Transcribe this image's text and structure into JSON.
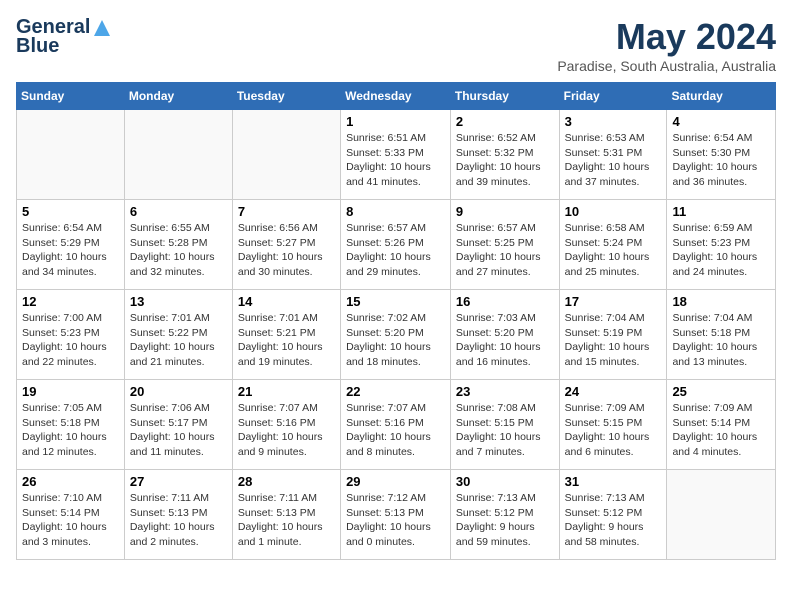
{
  "logo": {
    "line1": "General",
    "line2": "Blue"
  },
  "title": {
    "month_year": "May 2024",
    "location": "Paradise, South Australia, Australia"
  },
  "days_of_week": [
    "Sunday",
    "Monday",
    "Tuesday",
    "Wednesday",
    "Thursday",
    "Friday",
    "Saturday"
  ],
  "weeks": [
    [
      {
        "day": null
      },
      {
        "day": null
      },
      {
        "day": null
      },
      {
        "day": "1",
        "sunrise": "6:51 AM",
        "sunset": "5:33 PM",
        "daylight": "10 hours and 41 minutes."
      },
      {
        "day": "2",
        "sunrise": "6:52 AM",
        "sunset": "5:32 PM",
        "daylight": "10 hours and 39 minutes."
      },
      {
        "day": "3",
        "sunrise": "6:53 AM",
        "sunset": "5:31 PM",
        "daylight": "10 hours and 37 minutes."
      },
      {
        "day": "4",
        "sunrise": "6:54 AM",
        "sunset": "5:30 PM",
        "daylight": "10 hours and 36 minutes."
      }
    ],
    [
      {
        "day": "5",
        "sunrise": "6:54 AM",
        "sunset": "5:29 PM",
        "daylight": "10 hours and 34 minutes."
      },
      {
        "day": "6",
        "sunrise": "6:55 AM",
        "sunset": "5:28 PM",
        "daylight": "10 hours and 32 minutes."
      },
      {
        "day": "7",
        "sunrise": "6:56 AM",
        "sunset": "5:27 PM",
        "daylight": "10 hours and 30 minutes."
      },
      {
        "day": "8",
        "sunrise": "6:57 AM",
        "sunset": "5:26 PM",
        "daylight": "10 hours and 29 minutes."
      },
      {
        "day": "9",
        "sunrise": "6:57 AM",
        "sunset": "5:25 PM",
        "daylight": "10 hours and 27 minutes."
      },
      {
        "day": "10",
        "sunrise": "6:58 AM",
        "sunset": "5:24 PM",
        "daylight": "10 hours and 25 minutes."
      },
      {
        "day": "11",
        "sunrise": "6:59 AM",
        "sunset": "5:23 PM",
        "daylight": "10 hours and 24 minutes."
      }
    ],
    [
      {
        "day": "12",
        "sunrise": "7:00 AM",
        "sunset": "5:23 PM",
        "daylight": "10 hours and 22 minutes."
      },
      {
        "day": "13",
        "sunrise": "7:01 AM",
        "sunset": "5:22 PM",
        "daylight": "10 hours and 21 minutes."
      },
      {
        "day": "14",
        "sunrise": "7:01 AM",
        "sunset": "5:21 PM",
        "daylight": "10 hours and 19 minutes."
      },
      {
        "day": "15",
        "sunrise": "7:02 AM",
        "sunset": "5:20 PM",
        "daylight": "10 hours and 18 minutes."
      },
      {
        "day": "16",
        "sunrise": "7:03 AM",
        "sunset": "5:20 PM",
        "daylight": "10 hours and 16 minutes."
      },
      {
        "day": "17",
        "sunrise": "7:04 AM",
        "sunset": "5:19 PM",
        "daylight": "10 hours and 15 minutes."
      },
      {
        "day": "18",
        "sunrise": "7:04 AM",
        "sunset": "5:18 PM",
        "daylight": "10 hours and 13 minutes."
      }
    ],
    [
      {
        "day": "19",
        "sunrise": "7:05 AM",
        "sunset": "5:18 PM",
        "daylight": "10 hours and 12 minutes."
      },
      {
        "day": "20",
        "sunrise": "7:06 AM",
        "sunset": "5:17 PM",
        "daylight": "10 hours and 11 minutes."
      },
      {
        "day": "21",
        "sunrise": "7:07 AM",
        "sunset": "5:16 PM",
        "daylight": "10 hours and 9 minutes."
      },
      {
        "day": "22",
        "sunrise": "7:07 AM",
        "sunset": "5:16 PM",
        "daylight": "10 hours and 8 minutes."
      },
      {
        "day": "23",
        "sunrise": "7:08 AM",
        "sunset": "5:15 PM",
        "daylight": "10 hours and 7 minutes."
      },
      {
        "day": "24",
        "sunrise": "7:09 AM",
        "sunset": "5:15 PM",
        "daylight": "10 hours and 6 minutes."
      },
      {
        "day": "25",
        "sunrise": "7:09 AM",
        "sunset": "5:14 PM",
        "daylight": "10 hours and 4 minutes."
      }
    ],
    [
      {
        "day": "26",
        "sunrise": "7:10 AM",
        "sunset": "5:14 PM",
        "daylight": "10 hours and 3 minutes."
      },
      {
        "day": "27",
        "sunrise": "7:11 AM",
        "sunset": "5:13 PM",
        "daylight": "10 hours and 2 minutes."
      },
      {
        "day": "28",
        "sunrise": "7:11 AM",
        "sunset": "5:13 PM",
        "daylight": "10 hours and 1 minute."
      },
      {
        "day": "29",
        "sunrise": "7:12 AM",
        "sunset": "5:13 PM",
        "daylight": "10 hours and 0 minutes."
      },
      {
        "day": "30",
        "sunrise": "7:13 AM",
        "sunset": "5:12 PM",
        "daylight": "9 hours and 59 minutes."
      },
      {
        "day": "31",
        "sunrise": "7:13 AM",
        "sunset": "5:12 PM",
        "daylight": "9 hours and 58 minutes."
      },
      {
        "day": null
      }
    ]
  ]
}
